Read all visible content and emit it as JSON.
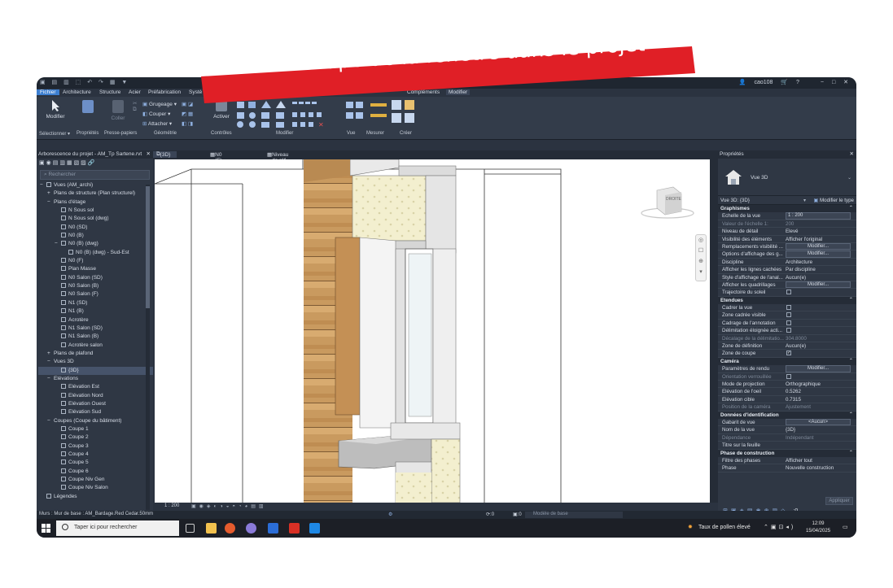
{
  "banner": {
    "text": "Zone de coupe de la fenêtre dans le projet",
    "color": "#e01f26"
  },
  "app": {
    "user": "cao108",
    "tabs": [
      "Fichier",
      "Architecture",
      "Structure",
      "Acier",
      "Préfabrication",
      "Systè",
      "Compléments",
      "Modifier"
    ],
    "active_tab": "Fichier"
  },
  "ribbon": {
    "modify": "Modifier",
    "properties": "Propriétés",
    "clipboard_paste": "Coller",
    "cut_tool": "Grugeage",
    "couper": "Couper",
    "attacher": "Attacher",
    "activer": "Activer",
    "groups": [
      "Sélectionner",
      "Propriétés",
      "Presse-papiers",
      "Géométrie",
      "Contrôles",
      "Modifier",
      "Vue",
      "Mesurer",
      "Créer"
    ]
  },
  "browser": {
    "title": "Arborescence du projet - AM_Tp Sartene.rvt",
    "search_placeholder": "Rechercher",
    "items": [
      {
        "label": "Vues (AM_archi)",
        "level": 0,
        "exp": "−",
        "icon": "root"
      },
      {
        "label": "Plans de structure (Plan structurel)",
        "level": 1,
        "exp": "+"
      },
      {
        "label": "Plans d'étage",
        "level": 1,
        "exp": "−"
      },
      {
        "label": "N Sous sol",
        "level": 2,
        "icon": "view"
      },
      {
        "label": "N Sous sol (dwg)",
        "level": 2,
        "icon": "view"
      },
      {
        "label": "N0 (SD)",
        "level": 2,
        "icon": "view"
      },
      {
        "label": "N0 (B)",
        "level": 2,
        "icon": "view"
      },
      {
        "label": "N0 (B) (dwg)",
        "level": 2,
        "exp": "−",
        "icon": "view"
      },
      {
        "label": "N0 (B) (dwg) - Sud-Est",
        "level": 3,
        "icon": "view"
      },
      {
        "label": "N0 (F)",
        "level": 2,
        "icon": "view"
      },
      {
        "label": "Plan Masse",
        "level": 2,
        "icon": "view"
      },
      {
        "label": "N0 Salon (SD)",
        "level": 2,
        "icon": "view"
      },
      {
        "label": "N0 Salon (B)",
        "level": 2,
        "icon": "view"
      },
      {
        "label": "N0 Salon (F)",
        "level": 2,
        "icon": "view"
      },
      {
        "label": "N1 (SD)",
        "level": 2,
        "icon": "view"
      },
      {
        "label": "N1 (B)",
        "level": 2,
        "icon": "view"
      },
      {
        "label": "Acrotère",
        "level": 2,
        "icon": "view"
      },
      {
        "label": "N1 Salon (SD)",
        "level": 2,
        "icon": "view"
      },
      {
        "label": "N1 Salon (B)",
        "level": 2,
        "icon": "view"
      },
      {
        "label": "Acrotère salon",
        "level": 2,
        "icon": "view"
      },
      {
        "label": "Plans de plafond",
        "level": 1,
        "exp": "+"
      },
      {
        "label": "Vues 3D",
        "level": 1,
        "exp": "−"
      },
      {
        "label": "{3D}",
        "level": 2,
        "icon": "view",
        "selected": true
      },
      {
        "label": "Elévations",
        "level": 1,
        "exp": "−"
      },
      {
        "label": "Elévation Est",
        "level": 2,
        "icon": "view"
      },
      {
        "label": "Elévation Nord",
        "level": 2,
        "icon": "view"
      },
      {
        "label": "Elévation Ouest",
        "level": 2,
        "icon": "view"
      },
      {
        "label": "Elévation Sud",
        "level": 2,
        "icon": "view"
      },
      {
        "label": "Coupes (Coupe du bâtiment)",
        "level": 1,
        "exp": "−"
      },
      {
        "label": "Coupe 1",
        "level": 2,
        "icon": "view"
      },
      {
        "label": "Coupe 2",
        "level": 2,
        "icon": "view"
      },
      {
        "label": "Coupe 3",
        "level": 2,
        "icon": "view"
      },
      {
        "label": "Coupe 4",
        "level": 2,
        "icon": "view"
      },
      {
        "label": "Coupe 5",
        "level": 2,
        "icon": "view"
      },
      {
        "label": "Coupe 6",
        "level": 2,
        "icon": "view"
      },
      {
        "label": "Coupe Niv Gen",
        "level": 2,
        "icon": "view"
      },
      {
        "label": "Coupe Niv Salon",
        "level": 2,
        "icon": "view"
      },
      {
        "label": "Légendes",
        "level": 0,
        "icon": "view"
      }
    ]
  },
  "view_tabs": [
    "{3D}",
    "N0 (F)",
    "Niveau de réf."
  ],
  "viewcube_label": "DROITE",
  "view_status": {
    "scale": "1 : 200"
  },
  "properties": {
    "title": "Propriétés",
    "type_name": "Vue 3D",
    "selector": "Vue 3D: {3D}",
    "edit_type": "Modifier le type",
    "apply": "Appliquer",
    "sections": [
      {
        "name": "Graphismes",
        "rows": [
          {
            "k": "Echelle de la vue",
            "v": "1 : 200",
            "kind": "input"
          },
          {
            "k": "Valeur de l'échelle   1:",
            "v": "200",
            "dim": true
          },
          {
            "k": "Niveau de détail",
            "v": "Elevé"
          },
          {
            "k": "Visibilité des éléments",
            "v": "Afficher l'original"
          },
          {
            "k": "Remplacements visibilité ...",
            "v": "Modifier...",
            "kind": "button"
          },
          {
            "k": "Options d'affichage des g...",
            "v": "Modifier...",
            "kind": "button"
          },
          {
            "k": "Discipline",
            "v": "Architecture"
          },
          {
            "k": "Afficher les lignes cachées",
            "v": "Par discipline"
          },
          {
            "k": "Style d'affichage de l'anal...",
            "v": "Aucun(e)"
          },
          {
            "k": "Afficher les quadrillages",
            "v": "Modifier...",
            "kind": "button"
          },
          {
            "k": "Trajectoire du soleil",
            "v": "",
            "kind": "check"
          }
        ]
      },
      {
        "name": "Etendues",
        "rows": [
          {
            "k": "Cadrer la vue",
            "v": "",
            "kind": "check"
          },
          {
            "k": "Zone cadrée visible",
            "v": "",
            "kind": "check"
          },
          {
            "k": "Cadrage de l'annotation",
            "v": "",
            "kind": "check"
          },
          {
            "k": "Délimitation éloignée acti...",
            "v": "",
            "kind": "check"
          },
          {
            "k": "Décalage de la délimitatio...",
            "v": "304.8000",
            "dim": true
          },
          {
            "k": "Zone de définition",
            "v": "Aucun(e)"
          },
          {
            "k": "Zone de coupe",
            "v": "✓",
            "kind": "check"
          }
        ]
      },
      {
        "name": "Caméra",
        "rows": [
          {
            "k": "Paramètres de rendu",
            "v": "Modifier...",
            "kind": "button"
          },
          {
            "k": "Orientation verrouillée",
            "v": "",
            "kind": "check",
            "dim": true
          },
          {
            "k": "Mode de projection",
            "v": "Orthographique"
          },
          {
            "k": "Elévation de l'oeil",
            "v": "0.5262"
          },
          {
            "k": "Elévation cible",
            "v": "0.7315"
          },
          {
            "k": "Position de la caméra",
            "v": "Ajustement",
            "dim": true
          }
        ]
      },
      {
        "name": "Données d'identification",
        "rows": [
          {
            "k": "Gabarit de vue",
            "v": "<Aucun>",
            "kind": "button"
          },
          {
            "k": "Nom de la vue",
            "v": "{3D}"
          },
          {
            "k": "Dépendance",
            "v": "Indépendant",
            "dim": true
          },
          {
            "k": "Titre sur la feuille",
            "v": ""
          }
        ]
      },
      {
        "name": "Phase de construction",
        "rows": [
          {
            "k": "Filtre des phases",
            "v": "Afficher tout"
          },
          {
            "k": "Phase",
            "v": "Nouvelle construction"
          }
        ]
      }
    ]
  },
  "status_bar": {
    "selection": "Murs : Mur de base : AM_Bardage.Red Cedar.50mm",
    "model": "Modèle de base",
    "zero1": ":0",
    "zero2": ":0",
    "filter": ":0"
  },
  "taskbar": {
    "search_placeholder": "Taper ici pour rechercher",
    "weather": "Taux de pollen élevé",
    "time": "12:09",
    "date": "15/04/2025"
  }
}
